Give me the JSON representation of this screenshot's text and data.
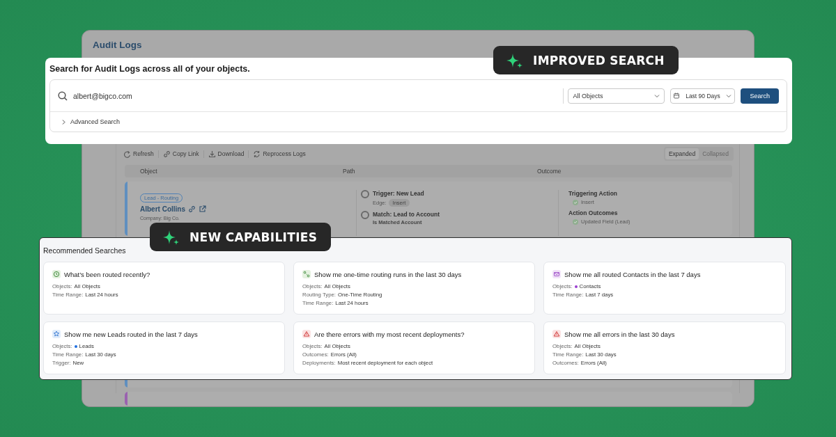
{
  "app_window": {
    "title": "Audit Logs",
    "toolbar": [
      {
        "kind": "refresh",
        "label": "Refresh"
      },
      {
        "kind": "link",
        "label": "Copy Link"
      },
      {
        "kind": "download",
        "label": "Download"
      },
      {
        "kind": "reprocess",
        "label": "Reprocess Logs"
      }
    ],
    "view_toggle": [
      {
        "label": "Expanded",
        "selected": true
      },
      {
        "label": "Collapsed",
        "selected": false
      }
    ],
    "table": {
      "columns": [
        "Object",
        "Path",
        "Outcome"
      ],
      "records": [
        {
          "color": "#5f8fbf",
          "tag": "Lead - Routing",
          "name": "Albert Collins",
          "details": [
            "Company: Big Co."
          ],
          "path": [
            {
              "title": "Trigger: New Lead",
              "label": "Edge:",
              "chip": "Insert"
            },
            {
              "title": "Match: Lead to Account",
              "sub": "Is Matched Account"
            }
          ],
          "outcome": [
            {
              "heading": "Triggering Action",
              "items": [
                "Insert"
              ]
            },
            {
              "heading": "Action Outcomes",
              "items": [
                "Updated Field (Lead)"
              ]
            }
          ]
        },
        {
          "color": "#9a62b0"
        }
      ]
    }
  },
  "improved_badge": {
    "label": "IMPROVED SEARCH"
  },
  "search_panel": {
    "title": "Search for Audit Logs across all of your objects.",
    "query": "albert@bigco.com",
    "object_select": "All Objects",
    "date_select": "Last 90 Days",
    "button": "Search",
    "advanced": "Advanced Search",
    "advanced_expanded": false
  },
  "capabilities_badge": {
    "label": "NEW CAPABILITIES"
  },
  "recommended": {
    "title": "Recommended Searches",
    "cards": [
      {
        "kind": "clock",
        "title": "What’s been routed recently?",
        "fields": [
          {
            "label": "Objects:",
            "value": "All Objects"
          },
          {
            "label": "Time Range:",
            "value": "Last 24 hours"
          }
        ]
      },
      {
        "kind": "route",
        "title": "Show me one-time routing runs in the last 30 days",
        "fields": [
          {
            "label": "Objects:",
            "value": "All Objects"
          },
          {
            "label": "Routing Type:",
            "value": "One-Time Routing"
          },
          {
            "label": "Time Range:",
            "value": "Last 24 hours"
          }
        ]
      },
      {
        "kind": "contact",
        "title": "Show me all routed Contacts in the last 7 days",
        "fields": [
          {
            "label": "Objects:",
            "value": "Contacts",
            "color": "#9b3fd1"
          },
          {
            "label": "Time Range:",
            "value": "Last 7 days"
          }
        ]
      },
      {
        "kind": "lead",
        "title": "Show me new Leads routed in the last 7 days",
        "fields": [
          {
            "label": "Objects:",
            "value": "Leads",
            "color": "#1f6fe0"
          },
          {
            "label": "Time Range:",
            "value": "Last 30 days"
          },
          {
            "label": "Trigger:",
            "value": "New"
          }
        ]
      },
      {
        "kind": "error",
        "title": "Are there errors with my most recent deployments?",
        "fields": [
          {
            "label": "Objects:",
            "value": "All Objects"
          },
          {
            "label": "Outcomes:",
            "value": "Errors (All)"
          },
          {
            "label": "Deployments:",
            "value": "Most recent deployment for each object"
          }
        ]
      },
      {
        "kind": "error",
        "title": "Show me all errors in the last 30 days",
        "fields": [
          {
            "label": "Objects:",
            "value": "All Objects"
          },
          {
            "label": "Time Range:",
            "value": "Last 30 days"
          },
          {
            "label": "Outcomes:",
            "value": "Errors (All)"
          }
        ]
      }
    ]
  }
}
